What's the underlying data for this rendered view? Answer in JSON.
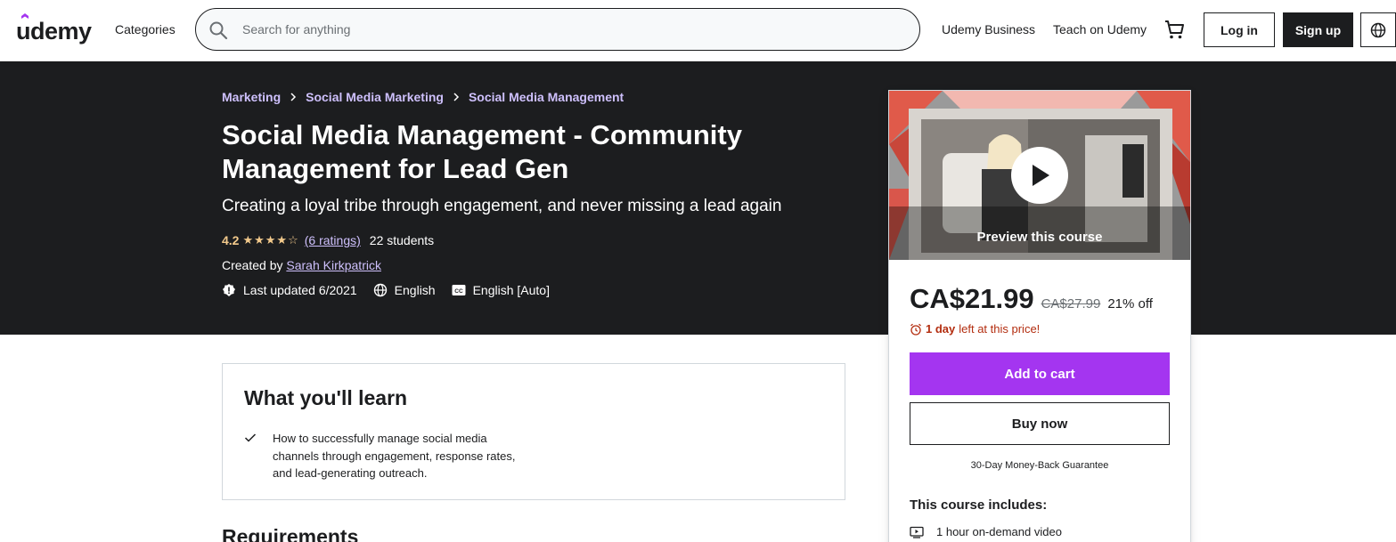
{
  "header": {
    "logo_text": "udemy",
    "categories_label": "Categories",
    "search_placeholder": "Search for anything",
    "business_link": "Udemy Business",
    "teach_link": "Teach on Udemy",
    "login_label": "Log in",
    "signup_label": "Sign up",
    "icons": [
      "search-icon",
      "cart-icon",
      "globe-icon"
    ]
  },
  "breadcrumb": [
    "Marketing",
    "Social Media Marketing",
    "Social Media Management"
  ],
  "course": {
    "title": "Social Media Management - Community Management for Lead Gen",
    "subtitle": "Creating a loyal tribe through engagement, and never missing a lead again",
    "rating": "4.2",
    "rating_value": 4.2,
    "ratings_count": "(6 ratings)",
    "students": "22 students",
    "created_by_label": "Created by",
    "author": "Sarah Kirkpatrick",
    "last_updated": "Last updated 6/2021",
    "language": "English",
    "captions": "English [Auto]"
  },
  "sidebar": {
    "preview_label": "Preview this course",
    "price": "CA$21.99",
    "original_price": "CA$27.99",
    "discount": "21% off",
    "deadline_bold": "1 day",
    "deadline_rest": "left at this price!",
    "add_to_cart": "Add to cart",
    "buy_now": "Buy now",
    "guarantee": "30-Day Money-Back Guarantee",
    "includes_title": "This course includes:",
    "includes": [
      "1 hour on-demand video"
    ]
  },
  "learn": {
    "title": "What you'll learn",
    "items": [
      "How to successfully manage social media channels through engagement, response rates, and lead-generating outreach."
    ]
  },
  "requirements_title": "Requirements",
  "colors": {
    "accent": "#a435f0",
    "dark_bg": "#1c1d1f",
    "link_purple": "#cec0fc",
    "star_gold": "#f3ca8c",
    "alert_red": "#b32d0f"
  }
}
